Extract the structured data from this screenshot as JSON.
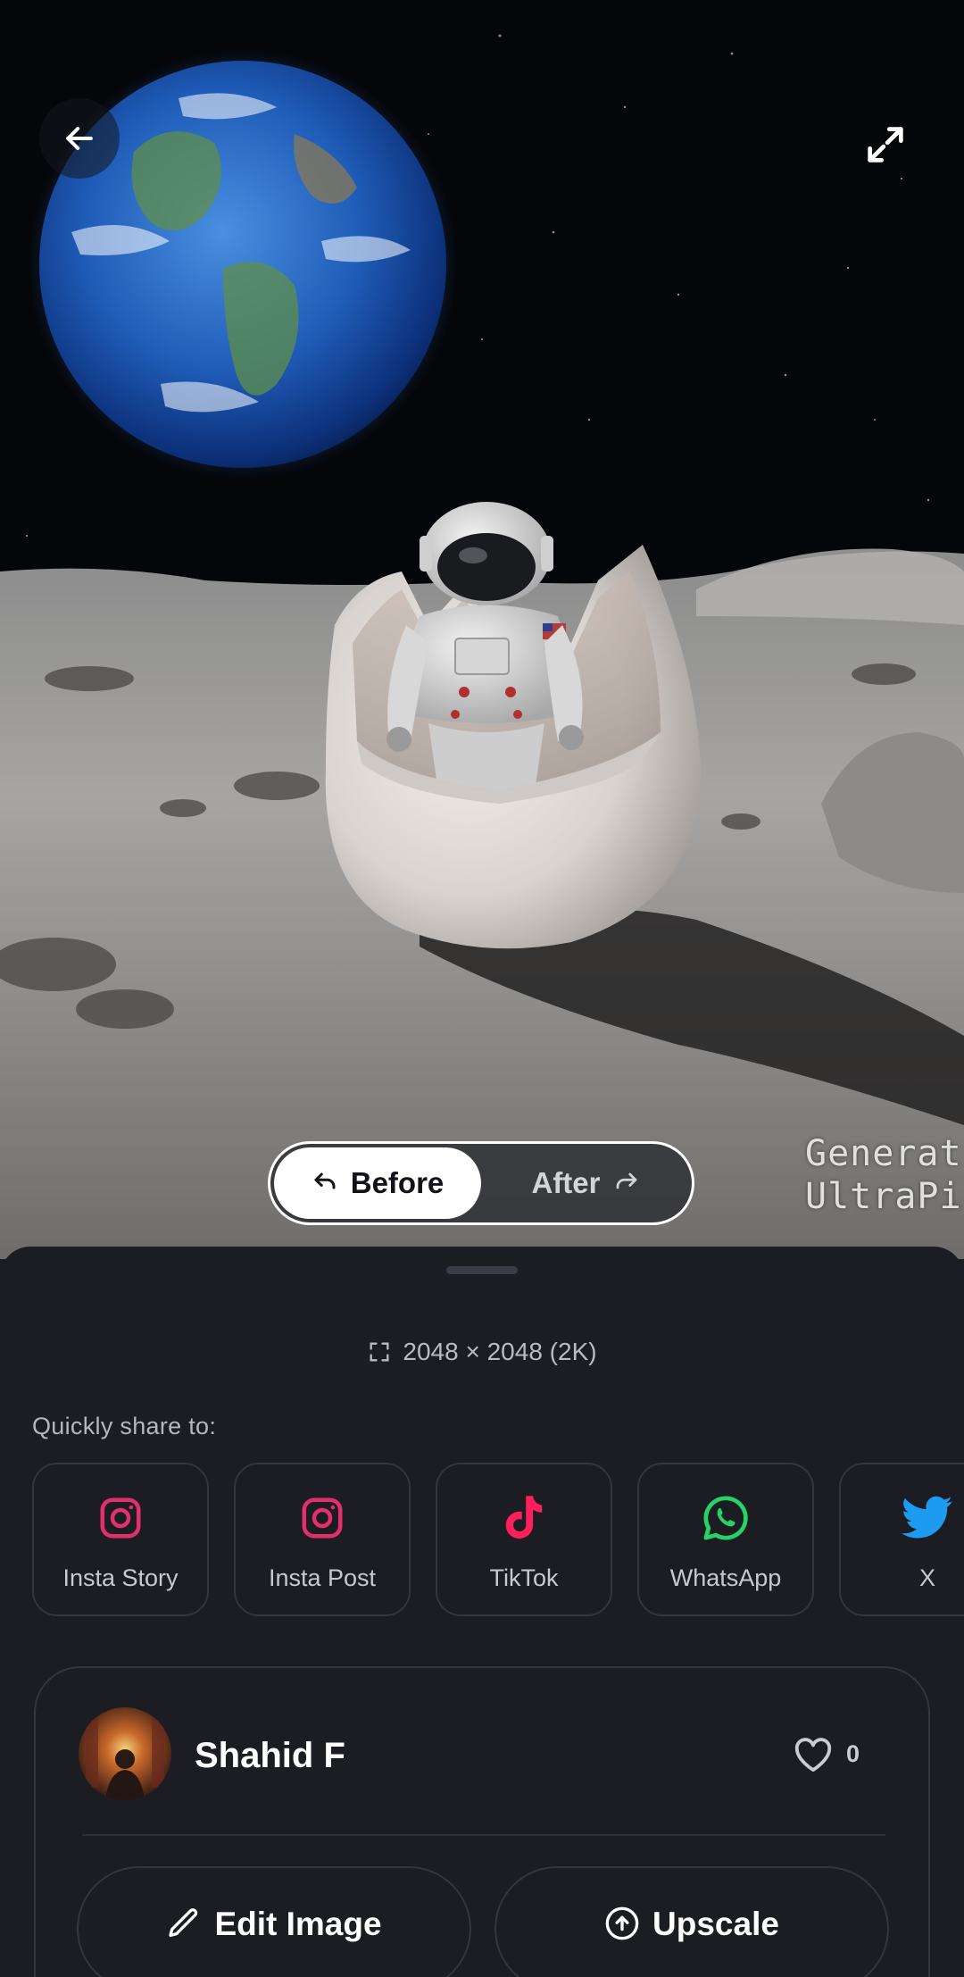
{
  "toolbar": {
    "back_icon": "arrow-left-icon",
    "expand_icon": "expand-arrows-icon"
  },
  "compare_toggle": {
    "before_label": "Before",
    "after_label": "After",
    "selected": "Before"
  },
  "watermark": {
    "text": "Generat\nUltraPi"
  },
  "sheet": {
    "resolution": "2048 × 2048 (2K)",
    "share_label": "Quickly share to:",
    "share_targets": [
      {
        "label": "Insta Story",
        "icon": "instagram-icon",
        "color": "#e1306c"
      },
      {
        "label": "Insta Post",
        "icon": "instagram-icon",
        "color": "#e1306c"
      },
      {
        "label": "TikTok",
        "icon": "tiktok-icon",
        "color": "#ff1f5a"
      },
      {
        "label": "WhatsApp",
        "icon": "whatsapp-icon",
        "color": "#25d366"
      },
      {
        "label": "X",
        "icon": "twitter-bird-icon",
        "color": "#1d9bf0"
      }
    ]
  },
  "author": {
    "name": "Shahid F",
    "likes": "0"
  },
  "actions": {
    "edit_label": "Edit Image",
    "upscale_label": "Upscale"
  },
  "colors": {
    "sheet_bg": "#1b1d22",
    "card_border": "#33363d",
    "toggle_active_bg": "#ffffff"
  }
}
